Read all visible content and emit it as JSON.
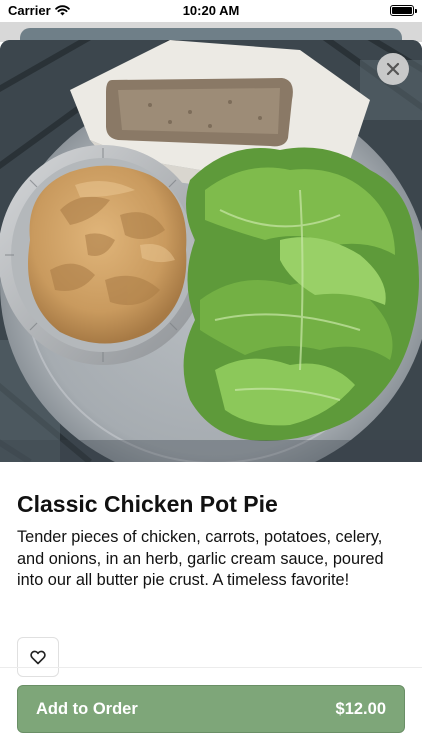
{
  "status_bar": {
    "carrier": "Carrier",
    "time": "10:20 AM",
    "battery_level": 1.0
  },
  "item": {
    "title": "Classic Chicken Pot Pie",
    "description": "Tender pieces of chicken, carrots, potatoes, celery, and onions, in an herb, garlic cream sauce, poured into our all butter pie crust. A timeless favorite!"
  },
  "icons": {
    "close": "close-icon",
    "favorite": "heart-outline-icon",
    "wifi": "wifi-icon",
    "battery": "battery-icon"
  },
  "order_button": {
    "label": "Add to Order",
    "price": "$12.00"
  },
  "colors": {
    "accent": "#7ea679",
    "close_button_bg": "#d2d2d2"
  }
}
